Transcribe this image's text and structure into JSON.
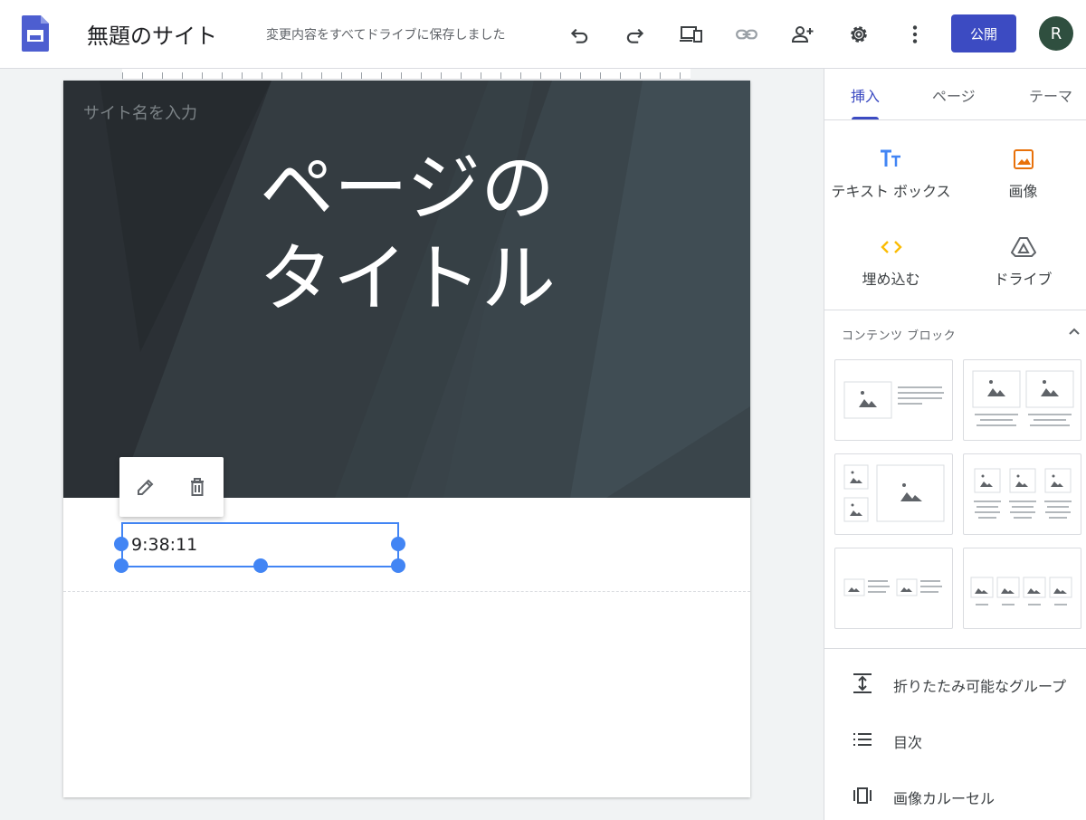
{
  "header": {
    "title": "無題のサイト",
    "save_status": "変更内容をすべてドライブに保存しました",
    "publish_label": "公開",
    "avatar_initial": "R",
    "icons": [
      "undo-icon",
      "redo-icon",
      "preview-devices-icon",
      "link-icon",
      "share-person-add-icon",
      "settings-gear-icon",
      "more-vert-icon"
    ]
  },
  "page": {
    "site_name_placeholder": "サイト名を入力",
    "title": "ページのタイトル",
    "textbox_text": "9:38:11"
  },
  "panel": {
    "tabs": [
      {
        "label": "挿入",
        "active": true
      },
      {
        "label": "ページ",
        "active": false
      },
      {
        "label": "テーマ",
        "active": false
      }
    ],
    "insert_items": [
      {
        "label": "テキスト ボックス",
        "icon": "text-box-icon"
      },
      {
        "label": "画像",
        "icon": "image-icon"
      },
      {
        "label": "埋め込む",
        "icon": "embed-code-icon"
      },
      {
        "label": "ドライブ",
        "icon": "drive-icon"
      }
    ],
    "content_blocks_heading": "コンテンツ ブロック",
    "layout_count": 6,
    "list_items": [
      {
        "label": "折りたたみ可能なグループ",
        "icon": "collapsible-group-icon"
      },
      {
        "label": "目次",
        "icon": "table-of-contents-icon"
      },
      {
        "label": "画像カルーセル",
        "icon": "image-carousel-icon"
      }
    ]
  },
  "colors": {
    "accent": "#3c4bc2",
    "selection": "#4285f4",
    "hero_bg": "#30383d",
    "text_icon": "#4285f4",
    "image_icon": "#e8710a",
    "embed_icon": "#fbbc04"
  }
}
